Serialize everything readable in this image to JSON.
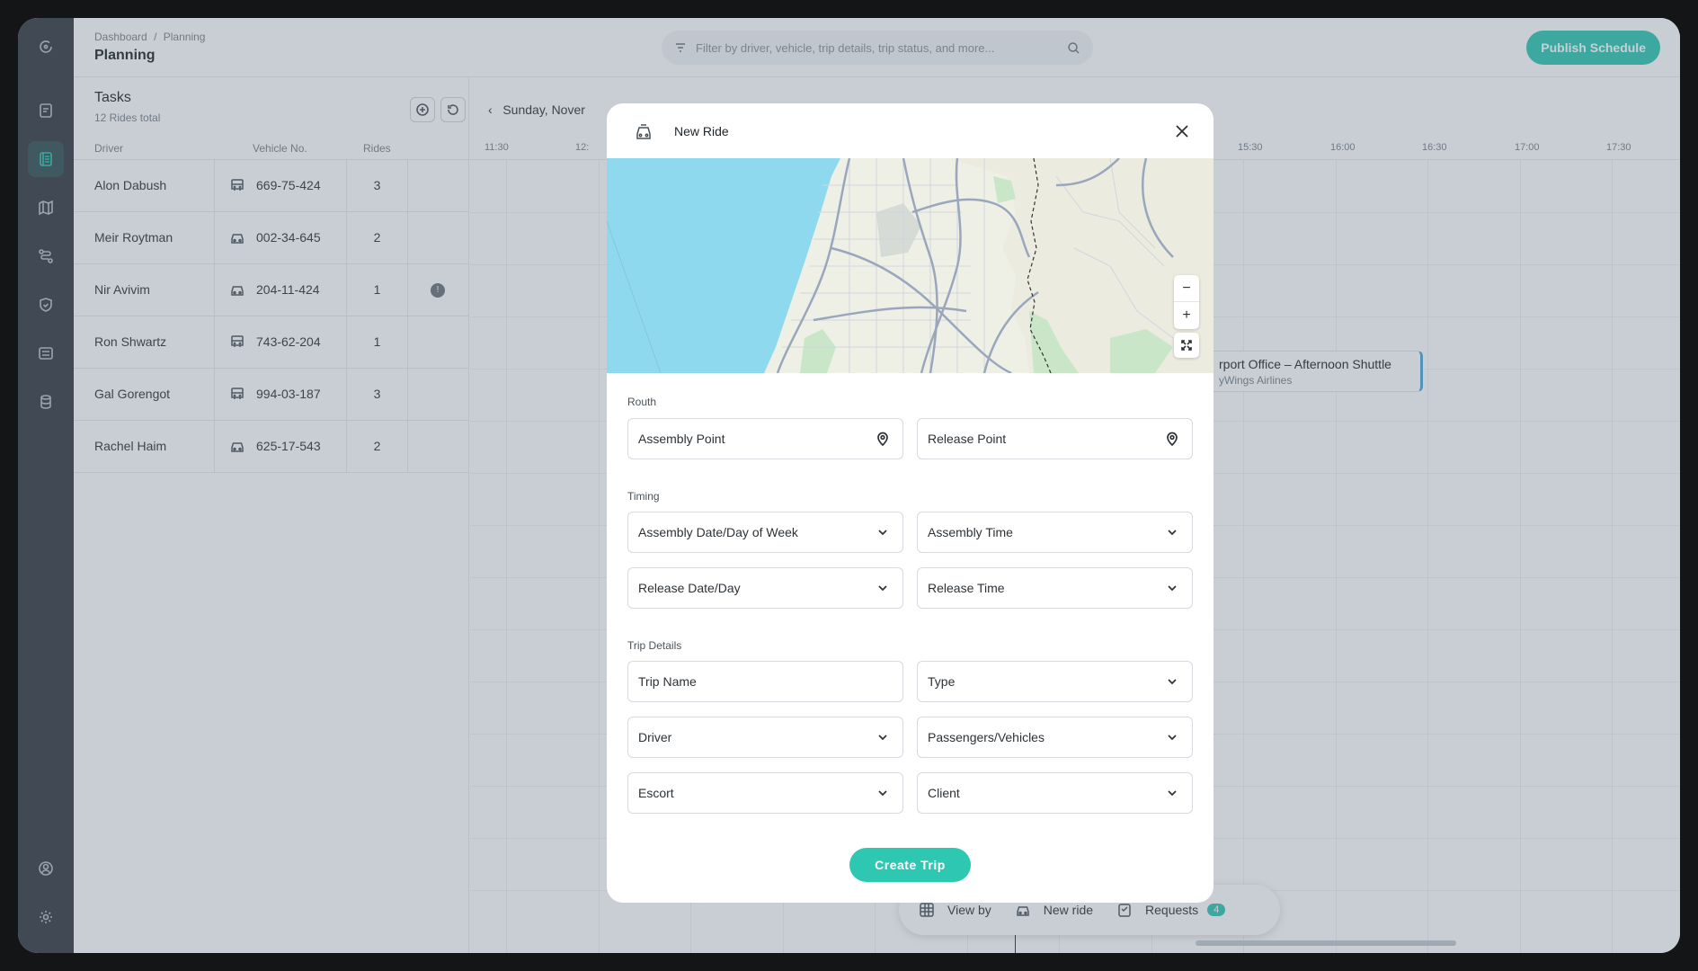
{
  "breadcrumb": {
    "root": "Dashboard",
    "sep": "/",
    "current": "Planning"
  },
  "page_title": "Planning",
  "search": {
    "placeholder": "Filter by driver, vehicle, trip details, trip status, and more..."
  },
  "publish_label": "Publish Schedule",
  "tasks": {
    "title": "Tasks",
    "subtitle": "12 Rides total",
    "columns": {
      "driver": "Driver",
      "vehicle": "Vehicle No.",
      "rides": "Rides"
    },
    "rows": [
      {
        "driver": "Alon Dabush",
        "vehicle": "669-75-424",
        "rides": "3",
        "vehicle_icon": "bus-icon"
      },
      {
        "driver": "Meir Roytman",
        "vehicle": "002-34-645",
        "rides": "2",
        "vehicle_icon": "car-icon"
      },
      {
        "driver": "Nir Avivim",
        "vehicle": "204-11-424",
        "rides": "1",
        "vehicle_icon": "car-icon",
        "warning": true
      },
      {
        "driver": "Ron Shwartz",
        "vehicle": "743-62-204",
        "rides": "1",
        "vehicle_icon": "bus-icon"
      },
      {
        "driver": "Gal Gorengot",
        "vehicle": "994-03-187",
        "rides": "3",
        "vehicle_icon": "bus-icon"
      },
      {
        "driver": "Rachel Haim",
        "vehicle": "625-17-543",
        "rides": "2",
        "vehicle_icon": "car-icon"
      }
    ]
  },
  "timeline": {
    "date": "Sunday, Nover",
    "hours": [
      "11:30",
      "12:",
      "15:30",
      "16:00",
      "16:30",
      "17:00",
      "17:30"
    ],
    "event": {
      "title": "rport Office – Afternoon Shuttle",
      "subtitle": "yWings Airlines"
    }
  },
  "bottom_bar": {
    "view_by": "View by",
    "new_ride": "New ride",
    "requests": "Requests",
    "requests_count": "4"
  },
  "modal": {
    "title": "New Ride",
    "map": {
      "zoom_out": "−",
      "zoom_in": "+"
    },
    "sections": {
      "route": "Routh",
      "timing": "Timing",
      "trip_details": "Trip Details"
    },
    "fields": {
      "assembly_point": "Assembly Point",
      "release_point": "Release Point",
      "assembly_date": "Assembly Date/Day of Week",
      "assembly_time": "Assembly Time",
      "release_date": "Release Date/Day",
      "release_time": "Release Time",
      "trip_name": "Trip Name",
      "type": "Type",
      "driver": "Driver",
      "passengers": "Passengers/Vehicles",
      "escort": "Escort",
      "client": "Client"
    },
    "create_label": "Create Trip"
  },
  "colors": {
    "accent": "#2dc7b2",
    "sidebar": "#343a40",
    "water": "#8fd9ee"
  }
}
